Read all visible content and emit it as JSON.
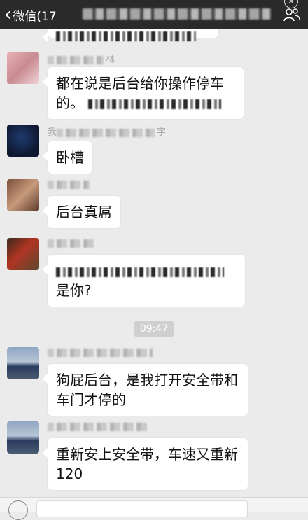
{
  "topbar": {
    "back_label": "微信(17",
    "title": ""
  },
  "messages": [
    {
      "nick_suffix": "",
      "text": ""
    },
    {
      "nick_suffix": "林",
      "line1": "都在说是后台给你操作停车",
      "line2": "的。"
    },
    {
      "nick_prefix": "我",
      "nick_suffix": "宇",
      "text": "卧槽"
    },
    {
      "nick_suffix": "",
      "text": "后台真屌"
    },
    {
      "nick_suffix": "",
      "line1": "",
      "line2": "是你?"
    },
    {
      "nick_suffix": "",
      "line1": "狗屁后台，是我打开安全带和",
      "line2": "车门才停的"
    },
    {
      "nick_suffix": "",
      "line1": "重新安上安全带，车速又重新",
      "line2": "120"
    }
  ],
  "time_divider": "09:47",
  "colors": {
    "topbar": "#2a2a2a",
    "background": "#ebebeb",
    "bubble": "#ffffff",
    "time_pill": "#cfcfcf"
  }
}
